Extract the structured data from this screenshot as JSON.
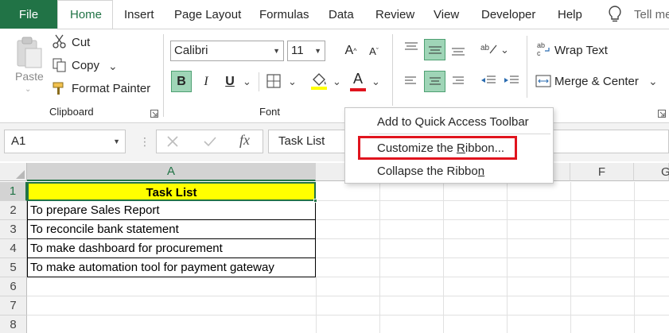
{
  "tabs": [
    "File",
    "Home",
    "Insert",
    "Page Layout",
    "Formulas",
    "Data",
    "Review",
    "View",
    "Developer",
    "Help",
    "Tell me"
  ],
  "active_tab": "Home",
  "clipboard": {
    "paste": "Paste",
    "cut": "Cut",
    "copy": "Copy",
    "format_painter": "Format Painter",
    "group_label": "Clipboard"
  },
  "font": {
    "name": "Calibri",
    "size": "11",
    "bold": "B",
    "italic": "I",
    "underline": "U",
    "font_color_glyph": "A",
    "group_label": "Font"
  },
  "alignment": {
    "wrap_text": "Wrap Text",
    "merge_center": "Merge & Center"
  },
  "formula_bar": {
    "name_box": "A1",
    "fx": "fx",
    "content": "Task List"
  },
  "columns": [
    "A",
    "F",
    "G"
  ],
  "rows": [
    "1",
    "2",
    "3",
    "4",
    "5",
    "6",
    "7",
    "8"
  ],
  "cells": {
    "A1": "Task List",
    "A2": "To prepare Sales Report",
    "A3": "To reconcile bank statement",
    "A4": "To make dashboard for procurement",
    "A5": "To make automation tool for payment gateway"
  },
  "context_menu": {
    "item1_pre": "Add to Quick Access Toolbar",
    "item2_pre": "Customize the ",
    "item2_key": "R",
    "item2_post": "ibbon...",
    "item3_pre": "Collapse the Ribbo",
    "item3_key": "n"
  },
  "colors": {
    "accent": "#217346",
    "selected_button": "#9fd5b7",
    "title_fill": "#ffff00",
    "highlight_box": "#e0141e"
  }
}
